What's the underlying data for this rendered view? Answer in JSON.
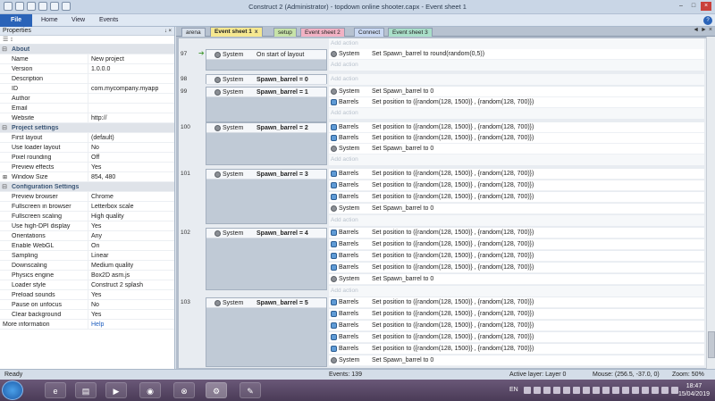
{
  "window": {
    "title": "Construct 2 (Administrator) - topdown online shooter.capx - Event sheet 1"
  },
  "ribbon": {
    "file": "File",
    "tabs": [
      "Home",
      "View",
      "Events"
    ],
    "help": "?"
  },
  "properties": {
    "header": "Properties",
    "pin": "↓ ×",
    "toolbar": "☰ ↕",
    "categories": [
      {
        "name": "About",
        "rows": [
          {
            "k": "Name",
            "v": "New project"
          },
          {
            "k": "Version",
            "v": "1.0.0.0"
          },
          {
            "k": "Description",
            "v": ""
          },
          {
            "k": "ID",
            "v": "com.mycompany.myapp"
          },
          {
            "k": "Author",
            "v": ""
          },
          {
            "k": "Email",
            "v": ""
          },
          {
            "k": "Website",
            "v": "http://"
          }
        ]
      },
      {
        "name": "Project settings",
        "rows": [
          {
            "k": "First layout",
            "v": "(default)"
          },
          {
            "k": "Use loader layout",
            "v": "No"
          },
          {
            "k": "Pixel rounding",
            "v": "Off"
          },
          {
            "k": "Preview effects",
            "v": "Yes"
          },
          {
            "k": "Window Size",
            "v": "854, 480"
          }
        ]
      },
      {
        "name": "Configuration Settings",
        "rows": [
          {
            "k": "Preview browser",
            "v": "Chrome"
          },
          {
            "k": "Fullscreen in browser",
            "v": "Letterbox scale"
          },
          {
            "k": "Fullscreen scaling",
            "v": "High quality"
          },
          {
            "k": "Use high-DPI display",
            "v": "Yes"
          },
          {
            "k": "Orientations",
            "v": "Any"
          },
          {
            "k": "Enable WebGL",
            "v": "On"
          },
          {
            "k": "Sampling",
            "v": "Linear"
          },
          {
            "k": "Downscaling",
            "v": "Medium quality"
          },
          {
            "k": "Physics engine",
            "v": "Box2D asm.js"
          },
          {
            "k": "Loader style",
            "v": "Construct 2 splash"
          },
          {
            "k": "Preload sounds",
            "v": "Yes"
          },
          {
            "k": "Pause on unfocus",
            "v": "No"
          },
          {
            "k": "Clear background",
            "v": "Yes"
          }
        ]
      }
    ],
    "more_info": "More information",
    "help": "Help"
  },
  "editor_tabs": [
    {
      "label": "arena",
      "color": "#d7dfe9"
    },
    {
      "label": "Event sheet 1",
      "color": "#f6e890",
      "active": true
    },
    {
      "label": "setup",
      "color": "#c7e3a8"
    },
    {
      "label": "Event sheet 2",
      "color": "#f2b2c4"
    },
    {
      "label": "Connect",
      "color": "#c9d8f2"
    },
    {
      "label": "Event sheet 3",
      "color": "#a9dfc9"
    }
  ],
  "tab_close": "x",
  "tab_nav": "◄ ► ×",
  "events": {
    "add_action": "Add action",
    "system": "System",
    "barrels": "Barrels",
    "set_pos": "Set position to ({random(128, 1500)} , {random(128, 700)})",
    "set_spawn_zero": "Set Spawn_barrel to 0",
    "rows": [
      {
        "num": "97",
        "cond": "On start of layout",
        "bold": false
      },
      {
        "num": "98",
        "cond": "Spawn_barrel = 0",
        "bold": true
      },
      {
        "num": "99",
        "cond": "Spawn_barrel = 1",
        "bold": true
      },
      {
        "num": "100",
        "cond": "Spawn_barrel = 2",
        "bold": true
      },
      {
        "num": "101",
        "cond": "Spawn_barrel = 3",
        "bold": true
      },
      {
        "num": "102",
        "cond": "Spawn_barrel = 4",
        "bold": true
      },
      {
        "num": "103",
        "cond": "Spawn_barrel = 5",
        "bold": true
      }
    ],
    "first_action": "Set Spawn_barrel to round(random(0,5))"
  },
  "status": {
    "ready": "Ready",
    "events": "Events: 139",
    "layer": "Active layer: Layer 0",
    "mouse": "Mouse: (256.5, -37.0, 0)",
    "zoom": "Zoom: 50%"
  },
  "taskbar": {
    "lang": "EN",
    "time": "18:47",
    "date": "15/04/2019"
  }
}
